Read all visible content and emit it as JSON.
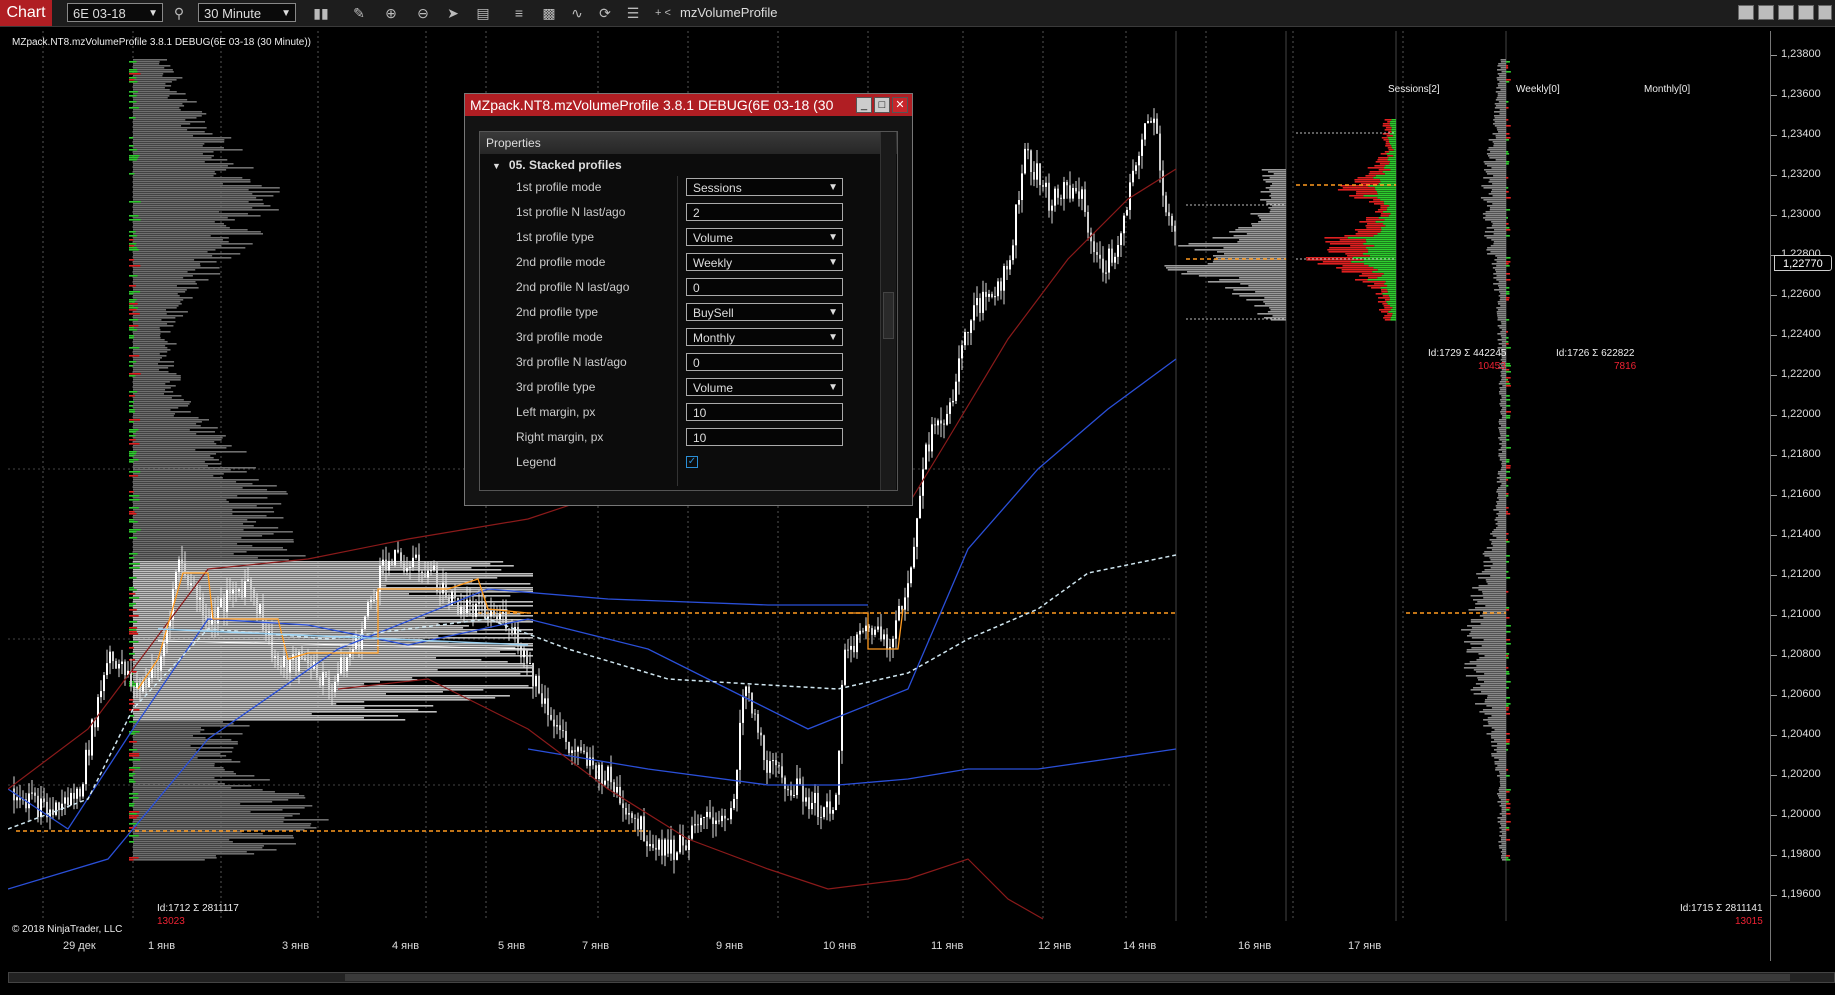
{
  "toolbar": {
    "chart_tab": "Chart",
    "instrument": "6E 03-18",
    "interval": "30 Minute",
    "indicator_name": "mzVolumeProfile",
    "icon_names": [
      "search-icon",
      "bar-type-icon",
      "pencil-icon",
      "zoom-icon",
      "pointer-icon",
      "properties-icon",
      "strategies-icon",
      "templates-icon",
      "drawing-tools-icon",
      "refresh-icon",
      "list-icon"
    ]
  },
  "chart": {
    "title": "MZpack.NT8.mzVolumeProfile 3.8.1 DEBUG(6E 03-18 (30 Minute))",
    "copyright": "© 2018 NinjaTrader, LLC",
    "current_price": "1,22770",
    "price_labels": [
      "1,23800",
      "1,23600",
      "1,23400",
      "1,23200",
      "1,23000",
      "1,22800",
      "1,22600",
      "1,22400",
      "1,22200",
      "1,22000",
      "1,21800",
      "1,21600",
      "1,21400",
      "1,21200",
      "1,21000",
      "1,20800",
      "1,20600",
      "1,20400",
      "1,20200",
      "1,20000",
      "1,19800",
      "1,19600"
    ],
    "time_labels": [
      "29 дек",
      "1 янв",
      "3 янв",
      "4 янв",
      "5 янв",
      "7 янв",
      "9 янв",
      "10 янв",
      "11 янв",
      "12 янв",
      "14 янв",
      "16 янв",
      "17 янв"
    ],
    "stacked_labels": [
      "Sessions[2]",
      "Weekly[0]",
      "Monthly[0]"
    ],
    "profile_stats": [
      {
        "id": "Id:1712 Σ 2811117",
        "volume": "13023"
      },
      {
        "id": "Id:1729 Σ 442245",
        "volume": "10453"
      },
      {
        "id": "Id:1726 Σ 622822",
        "volume": "7816"
      },
      {
        "id": "Id:1715 Σ 2811141",
        "volume": "13015"
      }
    ],
    "colors": {
      "accent": "#b01e23",
      "buy": "#2ecc2e",
      "sell": "#e02020",
      "poc": "#ff9a1f",
      "vwap": "#2a4fd8",
      "band": "#8b1a1a",
      "mid": "#cfe6f0"
    }
  },
  "dialog": {
    "title": "MZpack.NT8.mzVolumeProfile 3.8.1 DEBUG(6E 03-18 (30",
    "header": "Properties",
    "section": "05. Stacked profiles",
    "rows": [
      {
        "label": "1st profile mode",
        "value": "Sessions",
        "kind": "select"
      },
      {
        "label": "1st profile N last/ago",
        "value": "2",
        "kind": "input"
      },
      {
        "label": "1st profile type",
        "value": "Volume",
        "kind": "select"
      },
      {
        "label": "2nd profile mode",
        "value": "Weekly",
        "kind": "select"
      },
      {
        "label": "2nd profile N last/ago",
        "value": "0",
        "kind": "input"
      },
      {
        "label": "2nd profile type",
        "value": "BuySell",
        "kind": "select"
      },
      {
        "label": "3rd profile mode",
        "value": "Monthly",
        "kind": "select"
      },
      {
        "label": "3rd profile N last/ago",
        "value": "0",
        "kind": "input"
      },
      {
        "label": "3rd profile type",
        "value": "Volume",
        "kind": "select"
      },
      {
        "label": "Left margin, px",
        "value": "10",
        "kind": "input"
      },
      {
        "label": "Right margin, px",
        "value": "10",
        "kind": "input"
      },
      {
        "label": "Legend",
        "value": "",
        "kind": "checkbox",
        "checked": true
      }
    ]
  }
}
